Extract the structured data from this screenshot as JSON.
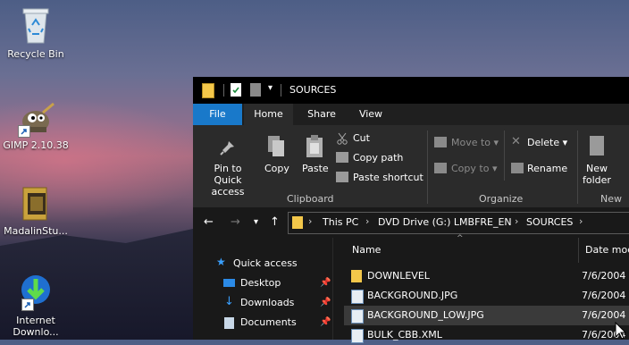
{
  "desktop": {
    "icons": [
      {
        "label": "Recycle Bin",
        "icon": "recycle-bin-icon"
      },
      {
        "label": "GIMP 2.10.38",
        "icon": "gimp-icon"
      },
      {
        "label": "MadalinStu...",
        "icon": "folder-app-icon"
      },
      {
        "label": "Internet Downlo...",
        "icon": "idm-icon"
      }
    ]
  },
  "window": {
    "title": "SOURCES",
    "tabs": [
      {
        "label": "File",
        "accent": "#1979ca"
      },
      {
        "label": "Home"
      },
      {
        "label": "Share"
      },
      {
        "label": "View"
      }
    ],
    "ribbon": {
      "clipboard": {
        "pin_label_1": "Pin to Quick",
        "pin_label_2": "access",
        "copy": "Copy",
        "paste": "Paste",
        "cut": "Cut",
        "copy_path": "Copy path",
        "paste_shortcut": "Paste shortcut",
        "group": "Clipboard"
      },
      "organize": {
        "move_to": "Move to",
        "copy_to": "Copy to",
        "delete": "Delete",
        "rename": "Rename",
        "group": "Organize"
      },
      "new": {
        "new_folder_1": "New",
        "new_folder_2": "folder",
        "group": "New"
      }
    },
    "address": {
      "crumbs": [
        "This PC",
        "DVD Drive (G:) LMBFRE_EN",
        "SOURCES"
      ],
      "separator": "›"
    },
    "nav_pane": [
      {
        "label": "Quick access",
        "icon": "star-icon"
      },
      {
        "label": "Desktop",
        "icon": "desktop-icon",
        "pinned": true
      },
      {
        "label": "Downloads",
        "icon": "download-icon",
        "pinned": true
      },
      {
        "label": "Documents",
        "icon": "documents-icon",
        "pinned": true
      }
    ],
    "columns": {
      "name": "Name",
      "date": "Date mod"
    },
    "files": [
      {
        "name": "DOWNLEVEL",
        "date": "7/6/2004",
        "type": "folder"
      },
      {
        "name": "BACKGROUND.JPG",
        "date": "7/6/2004",
        "type": "image"
      },
      {
        "name": "BACKGROUND_LOW.JPG",
        "date": "7/6/2004",
        "type": "image",
        "selected": true
      },
      {
        "name": "BULK_CBB.XML",
        "date": "7/6/2004",
        "type": "xml"
      }
    ]
  },
  "colors": {
    "accent": "#1979ca",
    "folder": "#f3c74a",
    "window_bg": "#191919",
    "ribbon_bg": "#2b2b2b"
  }
}
